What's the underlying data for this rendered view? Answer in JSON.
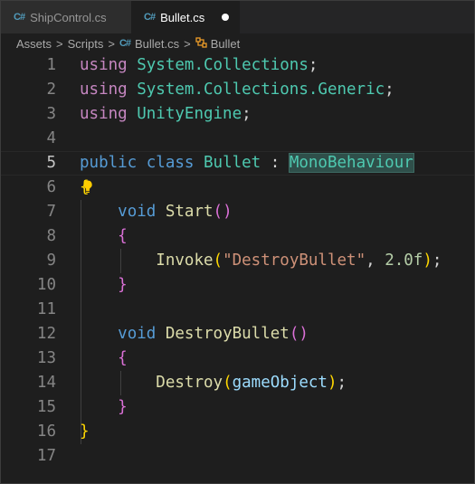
{
  "tabs": [
    {
      "label": "ShipControl.cs",
      "icon": "csharp-file-icon",
      "active": false
    },
    {
      "label": "Bullet.cs",
      "icon": "csharp-file-icon",
      "active": true,
      "unsaved": true
    }
  ],
  "breadcrumb": {
    "items": [
      "Assets",
      "Scripts",
      "Bullet.cs",
      "Bullet"
    ],
    "separator": ">"
  },
  "editor": {
    "current_line": 5,
    "line_numbers": [
      "1",
      "2",
      "3",
      "4",
      "5",
      "6",
      "7",
      "8",
      "9",
      "10",
      "11",
      "12",
      "13",
      "14",
      "15",
      "16",
      "17"
    ],
    "lines": [
      [
        [
          "using",
          "using"
        ],
        [
          " ",
          "p"
        ],
        [
          "System.Collections",
          "ns"
        ],
        [
          ";",
          "p"
        ]
      ],
      [
        [
          "using",
          "using"
        ],
        [
          " ",
          "p"
        ],
        [
          "System.Collections.Generic",
          "ns"
        ],
        [
          ";",
          "p"
        ]
      ],
      [
        [
          "using",
          "using"
        ],
        [
          " ",
          "p"
        ],
        [
          "UnityEngine",
          "ns"
        ],
        [
          ";",
          "p"
        ]
      ],
      [],
      [
        [
          "public",
          "kw"
        ],
        [
          " ",
          "p"
        ],
        [
          "class",
          "kw"
        ],
        [
          " ",
          "p"
        ],
        [
          "Bullet",
          "type"
        ],
        [
          " : ",
          "p"
        ],
        [
          "MonoBehaviour",
          "base"
        ]
      ],
      [
        [
          "{",
          "b1"
        ]
      ],
      [
        [
          "    ",
          "p"
        ],
        [
          "void",
          "kw"
        ],
        [
          " ",
          "p"
        ],
        [
          "Start",
          "fn"
        ],
        [
          "()",
          "b2"
        ]
      ],
      [
        [
          "    ",
          "p"
        ],
        [
          "{",
          "b2"
        ]
      ],
      [
        [
          "        ",
          "p"
        ],
        [
          "Invoke",
          "fn"
        ],
        [
          "(",
          "b1"
        ],
        [
          "\"DestroyBullet\"",
          "str"
        ],
        [
          ", ",
          "p"
        ],
        [
          "2.0f",
          "num"
        ],
        [
          ")",
          "b1"
        ],
        [
          ";",
          "p"
        ]
      ],
      [
        [
          "    ",
          "p"
        ],
        [
          "}",
          "b2"
        ]
      ],
      [],
      [
        [
          "    ",
          "p"
        ],
        [
          "void",
          "kw"
        ],
        [
          " ",
          "p"
        ],
        [
          "DestroyBullet",
          "fn"
        ],
        [
          "()",
          "b2"
        ]
      ],
      [
        [
          "    ",
          "p"
        ],
        [
          "{",
          "b2"
        ]
      ],
      [
        [
          "        ",
          "p"
        ],
        [
          "Destroy",
          "fn"
        ],
        [
          "(",
          "b1"
        ],
        [
          "gameObject",
          "var"
        ],
        [
          ")",
          "b1"
        ],
        [
          ";",
          "p"
        ]
      ],
      [
        [
          "    ",
          "p"
        ],
        [
          "}",
          "b2"
        ]
      ],
      [
        [
          "}",
          "b1"
        ]
      ],
      []
    ]
  },
  "colors": {
    "background": "#1e1e1e",
    "keyword": "#569cd6",
    "using_keyword": "#c586c0",
    "type": "#4ec9b0",
    "function": "#dcdcaa",
    "string": "#ce9178",
    "number": "#b5cea8",
    "variable": "#9cdcfe",
    "bracket_level1": "#ffd700",
    "bracket_level2": "#da70d6"
  }
}
